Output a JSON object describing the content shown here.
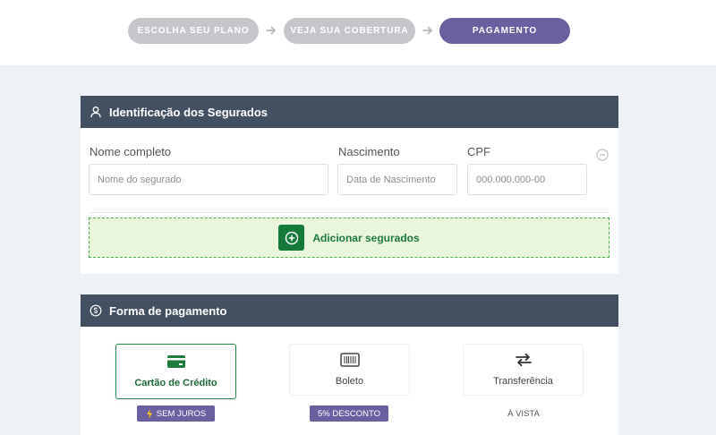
{
  "steps": {
    "items": [
      {
        "label": "ESCOLHA SEU PLANO",
        "state": "inactive"
      },
      {
        "label": "VEJA SUA COBERTURA",
        "state": "inactive"
      },
      {
        "label": "PAGAMENTO",
        "state": "active"
      }
    ]
  },
  "insured": {
    "title": "Identificação dos Segurados",
    "name_label": "Nome completo",
    "name_placeholder": "Nome do segurado",
    "birth_label": "Nascimento",
    "birth_placeholder": "Data de Nascimento",
    "cpf_label": "CPF",
    "cpf_placeholder": "000.000.000-00",
    "add_label": "Adicionar segurados"
  },
  "payment": {
    "title": "Forma de pagamento",
    "options": [
      {
        "label": "Cartão de Crédito",
        "icon": "credit-card-icon",
        "badge": "SEM JUROS",
        "selected": true
      },
      {
        "label": "Boleto",
        "icon": "barcode-icon",
        "badge": "5% DESCONTO",
        "selected": false
      },
      {
        "label": "Transferência",
        "icon": "transfer-icon",
        "badge": "À VISTA",
        "selected": false
      }
    ]
  },
  "colors": {
    "header_bg": "#435061",
    "active_step": "#6b5fa0",
    "inactive_step": "#c4c6ca",
    "accent_green": "#157a3a",
    "add_bg": "#eaf6dc"
  }
}
